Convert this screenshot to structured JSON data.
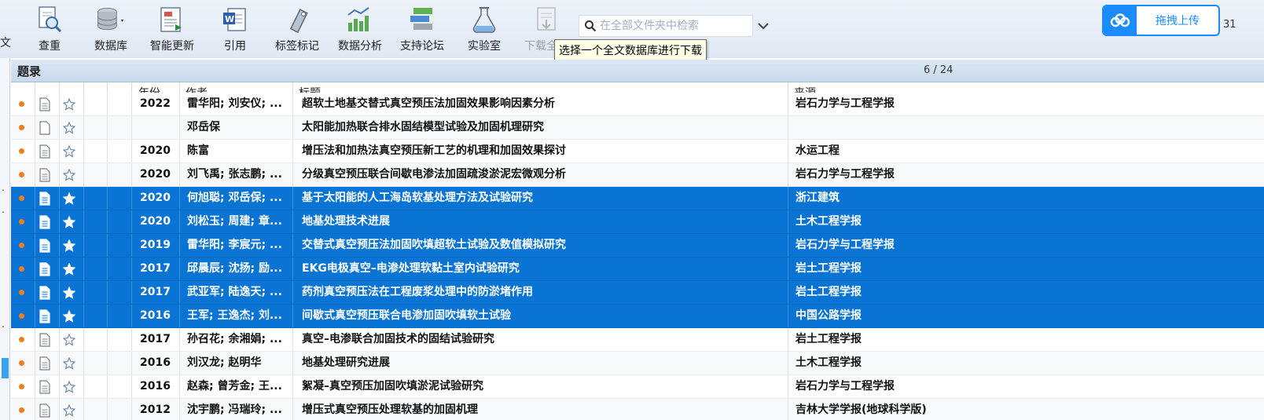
{
  "toolbar": {
    "left_edge_text": "文",
    "buttons": [
      {
        "label": "查重",
        "icon": "document-magnifier-icon"
      },
      {
        "label": "数据库",
        "icon": "database-icon"
      },
      {
        "label": "智能更新",
        "icon": "smart-update-icon"
      },
      {
        "label": "引用",
        "icon": "word-cite-icon"
      },
      {
        "label": "标签标记",
        "icon": "tag-icon"
      },
      {
        "label": "数据分析",
        "icon": "chart-icon"
      },
      {
        "label": "支持论坛",
        "icon": "forum-icon"
      },
      {
        "label": "实验室",
        "icon": "flask-icon"
      },
      {
        "label": "下载全文",
        "icon": "download-fulltext-icon",
        "disabled": true
      }
    ],
    "search_placeholder": "在全部文件夹中检索",
    "tooltip": "选择一个全文数据库进行下载",
    "upload_label": "拖拽上传",
    "right_edge_text": "31"
  },
  "panel": {
    "title": "题录",
    "counter": "6 / 24"
  },
  "columns": {
    "year": "年份",
    "author": "作者",
    "title": "标题",
    "source": "来源"
  },
  "rows": [
    {
      "year": "2022",
      "author": "雷华阳; 刘安仪; ...",
      "title": "超软土地基交替式真空预压法加固效果影响因素分析",
      "source": "岩石力学与工程学报",
      "selected": false,
      "has_doc": true
    },
    {
      "year": "",
      "author": "邓岳保",
      "title": "太阳能加热联合排水固结模型试验及加固机理研究",
      "source": "",
      "selected": false,
      "has_doc": false
    },
    {
      "year": "2020",
      "author": "陈富",
      "title": "增压法和加热法真空预压新工艺的机理和加固效果探讨",
      "source": "水运工程",
      "selected": false,
      "has_doc": true
    },
    {
      "year": "2020",
      "author": "刘飞禹; 张志鹏; ...",
      "title": "分级真空预压联合间歇电渗法加固疏浚淤泥宏微观分析",
      "source": "岩石力学与工程学报",
      "selected": false,
      "has_doc": true
    },
    {
      "year": "2020",
      "author": "何旭聪; 邓岳保; ...",
      "title": "基于太阳能的人工海岛软基处理方法及试验研究",
      "source": "浙江建筑",
      "selected": true,
      "has_doc": true
    },
    {
      "year": "2020",
      "author": "刘松玉; 周建; 章...",
      "title": "地基处理技术进展",
      "source": "土木工程学报",
      "selected": true,
      "has_doc": true
    },
    {
      "year": "2019",
      "author": "雷华阳; 李宸元; ...",
      "title": "交替式真空预压法加固吹填超软土试验及数值模拟研究",
      "source": "岩石力学与工程学报",
      "selected": true,
      "has_doc": true
    },
    {
      "year": "2017",
      "author": "邱晨辰; 沈扬; 励...",
      "title": "EKG电极真空–电渗处理软黏土室内试验研究",
      "source": "岩土工程学报",
      "selected": true,
      "has_doc": true
    },
    {
      "year": "2017",
      "author": "武亚军; 陆逸天; ...",
      "title": "药剂真空预压法在工程废浆处理中的防淤堵作用",
      "source": "岩土工程学报",
      "selected": true,
      "has_doc": true
    },
    {
      "year": "2016",
      "author": "王军; 王逸杰; 刘...",
      "title": "间歇式真空预压联合电渗加固吹填软土试验",
      "source": "中国公路学报",
      "selected": true,
      "has_doc": true
    },
    {
      "year": "2017",
      "author": "孙召花; 余湘娟; ...",
      "title": "真空–电渗联合加固技术的固结试验研究",
      "source": "岩土工程学报",
      "selected": false,
      "has_doc": true
    },
    {
      "year": "2016",
      "author": "刘汉龙; 赵明华",
      "title": "地基处理研究进展",
      "source": "土木工程学报",
      "selected": false,
      "has_doc": true
    },
    {
      "year": "2016",
      "author": "赵森; 曾芳金; 王...",
      "title": "絮凝–真空预压加固吹填淤泥试验研究",
      "source": "岩石力学与工程学报",
      "selected": false,
      "has_doc": true
    },
    {
      "year": "2012",
      "author": "沈宇鹏; 冯瑞玲; ...",
      "title": "增压式真空预压处理软基的加固机理",
      "source": "吉林大学学报(地球科学版)",
      "selected": false,
      "has_doc": true
    }
  ],
  "colors": {
    "selection": "#0a74d4",
    "dot": "#f07d1e",
    "upload_accent": "#1a8cff"
  }
}
